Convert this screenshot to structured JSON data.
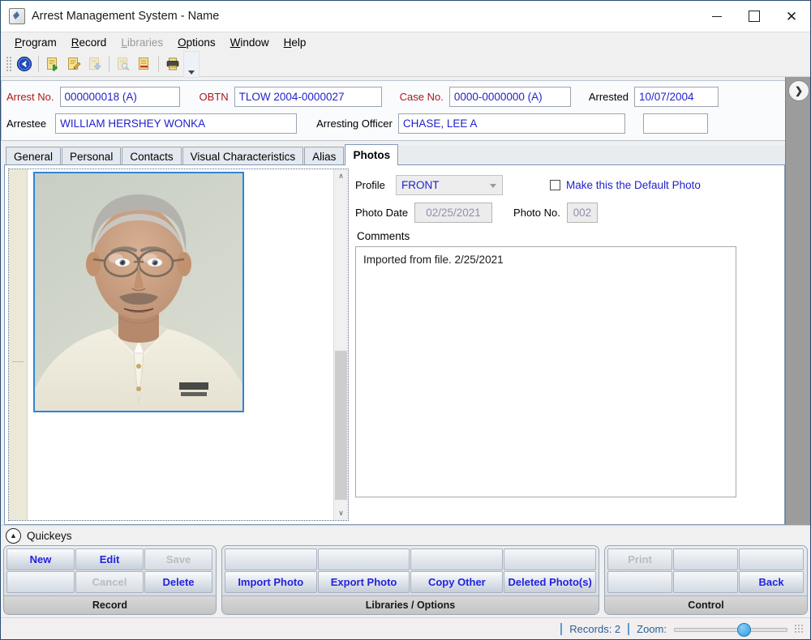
{
  "window": {
    "title": "Arrest Management System - Name",
    "icon": "app-diamond-icon",
    "minimize": "—",
    "maximize": "□",
    "close": "✕"
  },
  "menubar": {
    "items": [
      {
        "label": "Program",
        "accel": "P",
        "disabled": false
      },
      {
        "label": "Record",
        "accel": "R",
        "disabled": false
      },
      {
        "label": "Libraries",
        "accel": "L",
        "disabled": true
      },
      {
        "label": "Options",
        "accel": "O",
        "disabled": false
      },
      {
        "label": "Window",
        "accel": "W",
        "disabled": false
      },
      {
        "label": "Help",
        "accel": "H",
        "disabled": false
      }
    ]
  },
  "toolbar": {
    "buttons": [
      {
        "name": "back-icon",
        "disabled": false
      },
      {
        "name": "new-record-icon",
        "disabled": false
      },
      {
        "name": "edit-record-icon",
        "disabled": false
      },
      {
        "name": "save-record-icon",
        "disabled": true
      },
      {
        "name": "find-record-icon",
        "disabled": true
      },
      {
        "name": "delete-record-icon",
        "disabled": false
      },
      {
        "name": "print-icon",
        "disabled": false
      }
    ],
    "overflow": "overflow-chevron-icon"
  },
  "header": {
    "arrest_no_label": "Arrest No.",
    "arrest_no_value": "000000018 (A)",
    "obtn_label": "OBTN",
    "obtn_value": "TLOW 2004-0000027",
    "case_no_label": "Case No.",
    "case_no_value": "0000-0000000 (A)",
    "arrested_label": "Arrested",
    "arrested_value": "10/07/2004",
    "arrestee_label": "Arrestee",
    "arrestee_value": "WILLIAM HERSHEY WONKA",
    "arresting_officer_label": "Arresting Officer",
    "arresting_officer_value": "CHASE, LEE A",
    "extra_value": "",
    "expand_icon": "chevron-right-icon"
  },
  "tabs": [
    {
      "label": "General",
      "active": false
    },
    {
      "label": "Personal",
      "active": false
    },
    {
      "label": "Contacts",
      "active": false
    },
    {
      "label": "Visual Characteristics",
      "active": false
    },
    {
      "label": "Alias",
      "active": false
    },
    {
      "label": "Photos",
      "active": true
    }
  ],
  "photos_tab": {
    "profile_label": "Profile",
    "profile_value": "FRONT",
    "default_photo_label": "Make this the Default Photo",
    "default_photo_checked": false,
    "photo_date_label": "Photo Date",
    "photo_date_value": "02/25/2021",
    "photo_no_label": "Photo No.",
    "photo_no_value": "002",
    "comments_label": "Comments",
    "comments_value": "Imported from file.  2/25/2021",
    "scroll_up_icon": "∧",
    "scroll_down_icon": "∨"
  },
  "quickeys": {
    "title": "Quickeys",
    "collapse_icon": "∧",
    "groups": [
      {
        "footer": "Record",
        "rows": [
          [
            {
              "label": "New",
              "disabled": false
            },
            {
              "label": "Edit",
              "disabled": false
            },
            {
              "label": "Save",
              "disabled": true
            }
          ],
          [
            {
              "label": "",
              "disabled": false
            },
            {
              "label": "Cancel",
              "disabled": true
            },
            {
              "label": "Delete",
              "disabled": false
            }
          ]
        ]
      },
      {
        "footer": "Libraries / Options",
        "rows": [
          [
            {
              "label": "",
              "disabled": false
            },
            {
              "label": "",
              "disabled": false
            },
            {
              "label": "",
              "disabled": false
            },
            {
              "label": "",
              "disabled": false
            }
          ],
          [
            {
              "label": "Import Photo",
              "disabled": false
            },
            {
              "label": "Export Photo",
              "disabled": false
            },
            {
              "label": "Copy Other",
              "disabled": false
            },
            {
              "label": "Deleted Photo(s)",
              "disabled": false
            }
          ]
        ]
      },
      {
        "footer": "Control",
        "rows": [
          [
            {
              "label": "Print",
              "disabled": true
            },
            {
              "label": "",
              "disabled": false
            },
            {
              "label": "",
              "disabled": false
            }
          ],
          [
            {
              "label": "",
              "disabled": false
            },
            {
              "label": "",
              "disabled": false
            },
            {
              "label": "Back",
              "disabled": false
            }
          ]
        ]
      }
    ]
  },
  "statusbar": {
    "records_label": "Records: 2",
    "zoom_label": "Zoom:",
    "zoom_position_pct": 56
  }
}
